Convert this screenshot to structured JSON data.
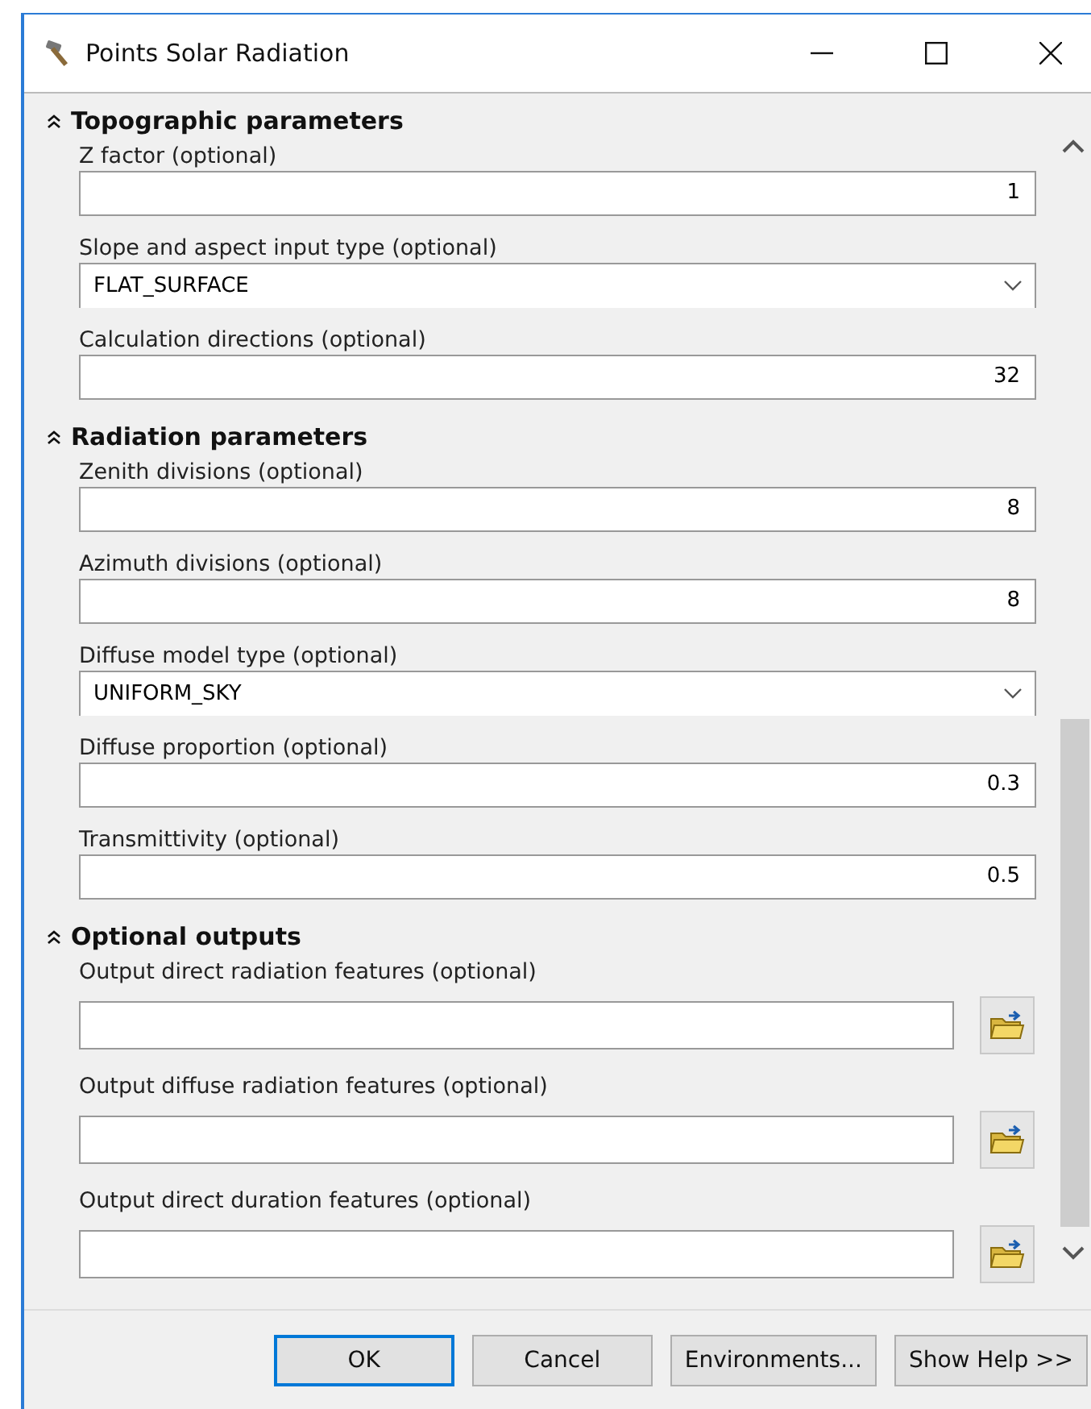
{
  "window": {
    "title": "Points Solar Radiation"
  },
  "sections": [
    {
      "title": "Topographic parameters",
      "params": [
        {
          "label": "Z factor (optional)",
          "kind": "number",
          "value": "1"
        },
        {
          "label": "Slope and aspect input type (optional)",
          "kind": "dropdown",
          "value": "FLAT_SURFACE"
        },
        {
          "label": "Calculation directions (optional)",
          "kind": "number",
          "value": "32"
        }
      ]
    },
    {
      "title": "Radiation parameters",
      "params": [
        {
          "label": "Zenith divisions (optional)",
          "kind": "number",
          "value": "8"
        },
        {
          "label": "Azimuth divisions (optional)",
          "kind": "number",
          "value": "8"
        },
        {
          "label": "Diffuse model type (optional)",
          "kind": "dropdown",
          "value": "UNIFORM_SKY"
        },
        {
          "label": "Diffuse proportion (optional)",
          "kind": "number",
          "value": "0.3"
        },
        {
          "label": "Transmittivity (optional)",
          "kind": "number",
          "value": "0.5"
        }
      ]
    },
    {
      "title": "Optional outputs",
      "params": [
        {
          "label": "Output direct radiation features (optional)",
          "kind": "output"
        },
        {
          "label": "Output diffuse radiation features (optional)",
          "kind": "output"
        },
        {
          "label": "Output direct duration features (optional)",
          "kind": "output"
        }
      ]
    }
  ],
  "buttons": [
    {
      "label": "OK",
      "selected": true
    },
    {
      "label": "Cancel",
      "selected": false
    },
    {
      "label": "Environments...",
      "selected": false
    },
    {
      "label": "Show Help >>",
      "selected": false
    }
  ]
}
